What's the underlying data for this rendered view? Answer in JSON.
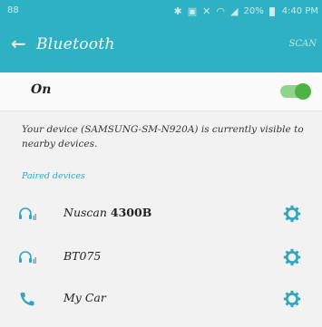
{
  "status_bar": {
    "left_text": "88",
    "icons": [
      "bluetooth-icon",
      "nfc-icon",
      "mute-icon",
      "wifi-icon",
      "signal-icon"
    ],
    "battery": "20%",
    "time": "4:40 PM"
  },
  "header": {
    "title": "Bluetooth",
    "scan_label": "SCAN"
  },
  "toggle": {
    "label": "On",
    "state": true
  },
  "visibility_message": "Your device (SAMSUNG-SM-N920A) is currently visible to nearby devices.",
  "paired": {
    "section_title": "Paired devices",
    "devices": [
      {
        "name": "Nuscan",
        "model": "4300B",
        "icon": "headset-icon"
      },
      {
        "name": "BT075",
        "model": "",
        "icon": "headset-icon"
      },
      {
        "name": "My Car",
        "model": "",
        "icon": "phone-icon"
      }
    ]
  },
  "colors": {
    "accent": "#2fb1c4",
    "toggle_on": "#4fb247",
    "gear": "#2fa8bf",
    "background": "#f2f2f2"
  }
}
